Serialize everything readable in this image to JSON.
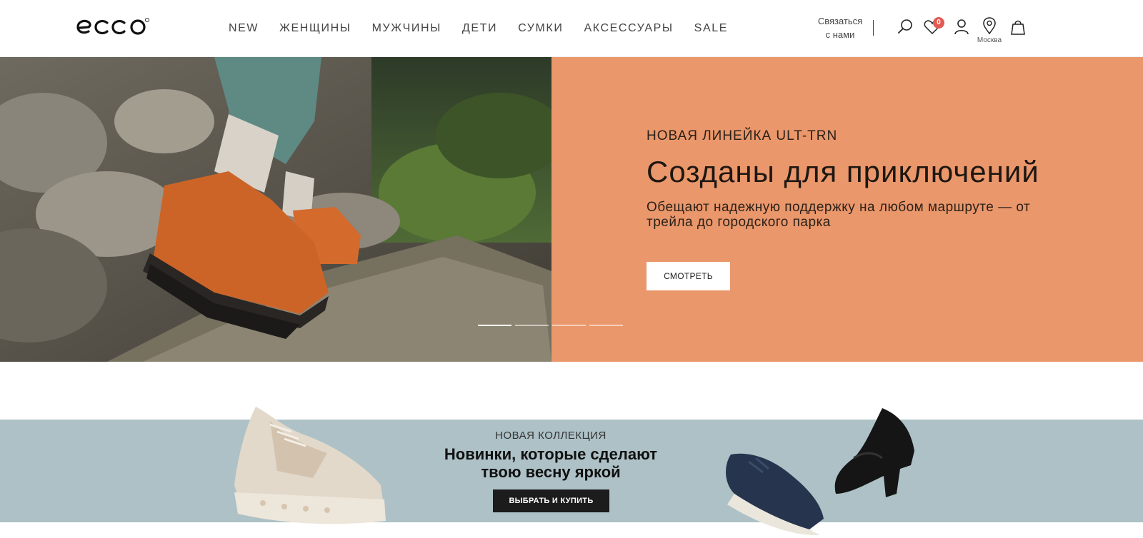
{
  "header": {
    "logo_text": "ecco",
    "nav": [
      "NEW",
      "ЖЕНЩИНЫ",
      "МУЖЧИНЫ",
      "ДЕТИ",
      "СУМКИ",
      "АКСЕССУАРЫ",
      "SALE"
    ],
    "contact_line1": "Связаться",
    "contact_line2": "с нами",
    "wishlist_count": "0",
    "city": "Москва",
    "icons": [
      "search-icon",
      "heart-icon",
      "user-icon",
      "location-pin-icon",
      "shopping-bag-icon"
    ]
  },
  "hero": {
    "eyebrow": "НОВАЯ ЛИНЕЙКА ULT-TRN",
    "title": "Созданы для приключений",
    "subtitle": "Обещают надежную поддержку на любом маршруте — от трейла до городского парка",
    "button": "СМОТРЕТЬ",
    "slides_total": 4,
    "active_slide": 1,
    "panel_color": "#ea976b"
  },
  "promo": {
    "eyebrow": "НОВАЯ КОЛЛЕКЦИЯ",
    "title_line1": "Новинки, которые сделают",
    "title_line2": "твою весну яркой",
    "button": "ВЫБРАТЬ И КУПИТЬ",
    "background_color": "#adc1c6"
  }
}
